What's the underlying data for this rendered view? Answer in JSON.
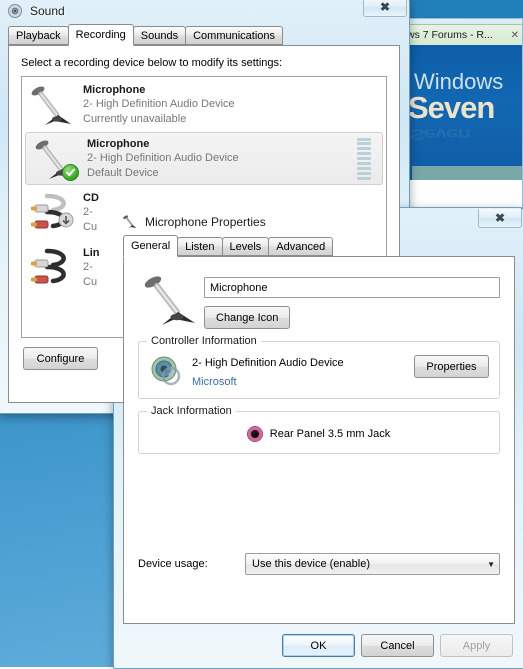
{
  "desktop": {
    "background_color": "#2b87bf"
  },
  "browser": {
    "tab_label": "ws 7 Forums - R...",
    "tab_close_glyph": "✕",
    "banner_line1": "Windows",
    "banner_line2": "Seven",
    "banner_shadow": "Seven"
  },
  "sound_window": {
    "title": "Sound",
    "close_glyph": "✖",
    "tabs": [
      {
        "label": "Playback",
        "active": false
      },
      {
        "label": "Recording",
        "active": true
      },
      {
        "label": "Sounds",
        "active": false
      },
      {
        "label": "Communications",
        "active": false
      }
    ],
    "instruction": "Select a recording device below to modify its settings:",
    "devices": [
      {
        "name": "Microphone",
        "driver": "2- High Definition Audio Device",
        "status": "Currently unavailable",
        "icon": "microphone-icon",
        "selected": false,
        "default_device": false,
        "has_meter": false
      },
      {
        "name": "Microphone",
        "driver": "2- High Definition Audio Device",
        "status": "Default Device",
        "icon": "microphone-icon",
        "selected": true,
        "default_device": true,
        "has_meter": true
      },
      {
        "name": "CD",
        "driver": "2-",
        "status": "Cu",
        "icon": "rca-cable-icon",
        "selected": false,
        "default_device": false,
        "has_meter": false
      },
      {
        "name": "Lin",
        "driver": "2-",
        "status": "Cu",
        "icon": "rca-cable-icon",
        "selected": false,
        "default_device": false,
        "has_meter": false
      }
    ],
    "configure_label": "Configure"
  },
  "props_window": {
    "title": "Microphone Properties",
    "close_glyph": "✖",
    "title_icon": "microphone-icon",
    "tabs": [
      {
        "label": "General",
        "active": true
      },
      {
        "label": "Listen",
        "active": false
      },
      {
        "label": "Levels",
        "active": false
      },
      {
        "label": "Advanced",
        "active": false
      }
    ],
    "device_icon": "microphone-icon",
    "name_value": "Microphone",
    "change_icon_label": "Change Icon",
    "controller": {
      "group_title": "Controller Information",
      "icon": "audio-controller-icon",
      "device_name": "2- High Definition Audio Device",
      "vendor_link": "Microsoft",
      "properties_label": "Properties"
    },
    "jack": {
      "group_title": "Jack Information",
      "icon": "pink-jack-icon",
      "label": "Rear Panel 3.5 mm Jack",
      "jack_color": "#d4629c"
    },
    "usage": {
      "label": "Device usage:",
      "selected": "Use this device (enable)",
      "arrow_glyph": "▼"
    },
    "buttons": {
      "ok": "OK",
      "cancel": "Cancel",
      "apply": "Apply"
    }
  }
}
